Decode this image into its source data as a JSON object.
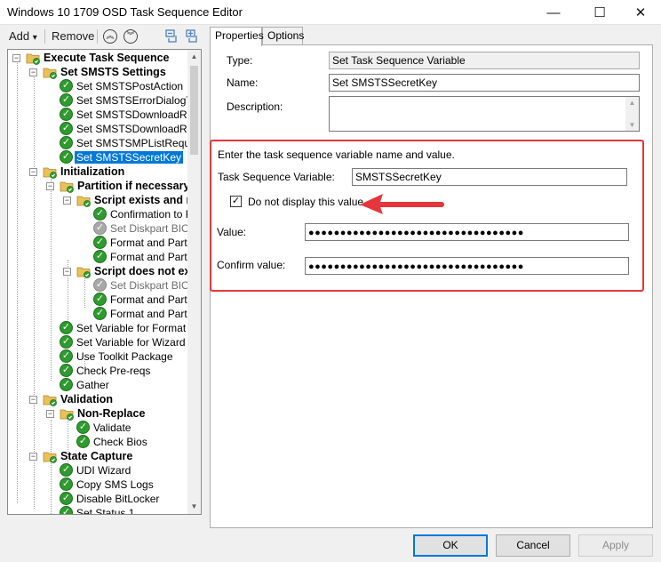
{
  "window": {
    "title": "Windows 10 1709 OSD Task Sequence Editor",
    "minimize_glyph": "—",
    "maximize_glyph": "☐",
    "close_glyph": "✕"
  },
  "toolbar": {
    "add_label": "Add",
    "add_arrow": "▾",
    "remove_label": "Remove",
    "move_up_glyph": "︽",
    "move_down_glyph": "︾"
  },
  "tree": {
    "nodes": [
      {
        "label": "Execute Task Sequence",
        "type": "group"
      },
      {
        "label": "Set SMSTS Settings",
        "type": "group"
      },
      {
        "label": "Set SMSTSPostAction",
        "type": "step"
      },
      {
        "label": "Set SMSTSErrorDialogTim",
        "type": "step"
      },
      {
        "label": "Set SMSTSDownloadRetr",
        "type": "step"
      },
      {
        "label": "Set SMSTSDownloadRetr",
        "type": "step"
      },
      {
        "label": "Set SMSTSMPListReques",
        "type": "step"
      },
      {
        "label": "Set SMSTSSecretKey",
        "type": "step",
        "selected": true
      },
      {
        "label": "Initialization",
        "type": "group"
      },
      {
        "label": "Partition if necessary",
        "type": "group"
      },
      {
        "label": "Script exists and n",
        "type": "group"
      },
      {
        "label": "Confirmation to Pa",
        "type": "step"
      },
      {
        "label": "Set Diskpart BIOS",
        "type": "step",
        "disabled": true
      },
      {
        "label": "Format and Partitic",
        "type": "step"
      },
      {
        "label": "Format and Partitic",
        "type": "step"
      },
      {
        "label": "Script does not ex",
        "type": "group"
      },
      {
        "label": "Set Diskpart BIOS",
        "type": "step",
        "disabled": true
      },
      {
        "label": "Format and Partitic",
        "type": "step"
      },
      {
        "label": "Format and Partitic",
        "type": "step"
      },
      {
        "label": "Set Variable for Format an",
        "type": "step"
      },
      {
        "label": "Set Variable for Wizard",
        "type": "step"
      },
      {
        "label": "Use Toolkit Package",
        "type": "step"
      },
      {
        "label": "Check Pre-reqs",
        "type": "step"
      },
      {
        "label": "Gather",
        "type": "step"
      },
      {
        "label": "Validation",
        "type": "group"
      },
      {
        "label": "Non-Replace",
        "type": "group"
      },
      {
        "label": "Validate",
        "type": "step"
      },
      {
        "label": "Check Bios",
        "type": "step"
      },
      {
        "label": "State Capture",
        "type": "group"
      },
      {
        "label": "UDI Wizard",
        "type": "step"
      },
      {
        "label": "Copy SMS Logs",
        "type": "step"
      },
      {
        "label": "Disable BitLocker",
        "type": "step"
      },
      {
        "label": "Set Status 1",
        "type": "step"
      }
    ]
  },
  "tabs": [
    {
      "label": "Properties"
    },
    {
      "label": "Options"
    }
  ],
  "properties": {
    "type_label": "Type:",
    "type_value": "Set Task Sequence Variable",
    "name_label": "Name:",
    "name_value": "Set SMSTSSecretKey",
    "description_label": "Description:",
    "description_value": "",
    "instruction": "Enter the task sequence variable name and value.",
    "variable_label": "Task Sequence Variable:",
    "variable_value": "SMSTSSecretKey",
    "hide_value_label": "Do not display this value",
    "hide_value_checked": true,
    "value_label": "Value:",
    "value_masked": "●●●●●●●●●●●●●●●●●●●●●●●●●●●●●●●●●●",
    "confirm_label": "Confirm value:",
    "confirm_masked": "●●●●●●●●●●●●●●●●●●●●●●●●●●●●●●●●●●"
  },
  "buttons": {
    "ok": "OK",
    "cancel": "Cancel",
    "apply": "Apply"
  },
  "colors": {
    "highlight": "#e5363b",
    "selection": "#0078d7",
    "step_check": "#2e9b2e"
  }
}
